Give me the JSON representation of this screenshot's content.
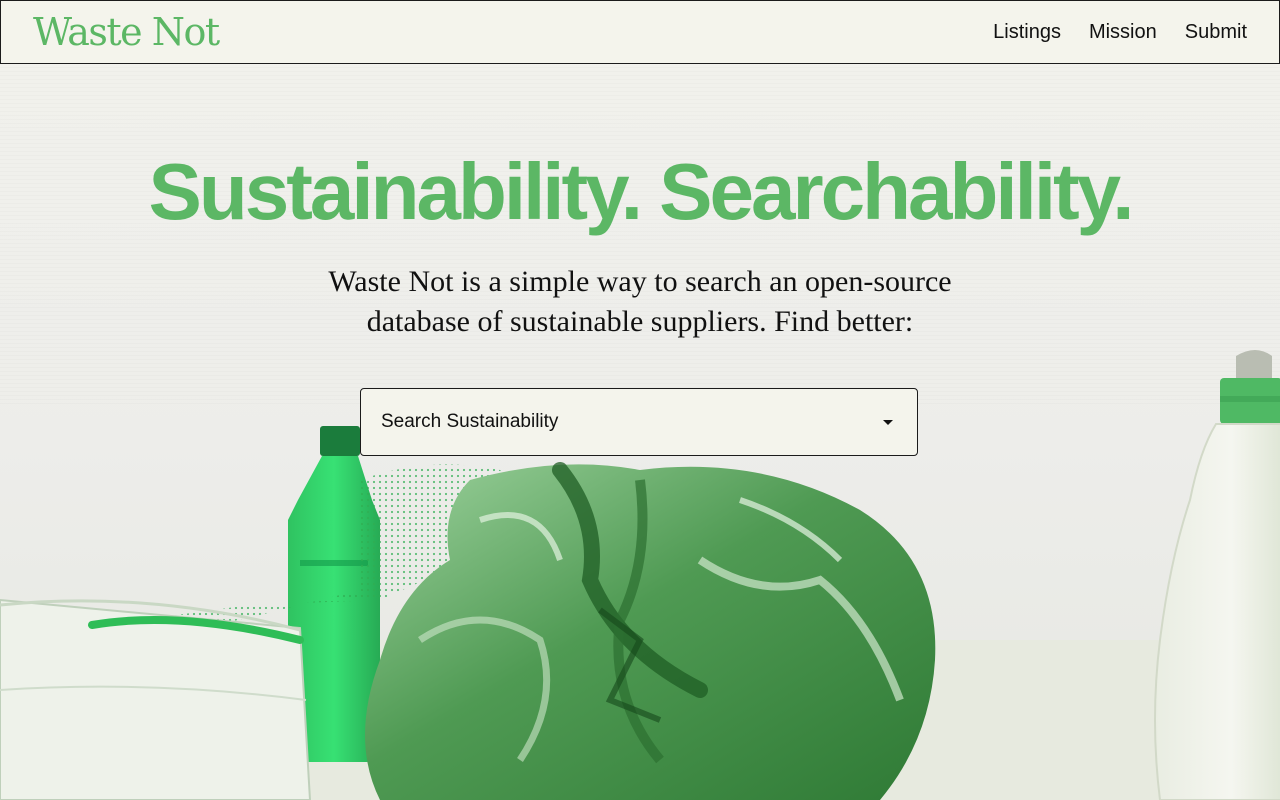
{
  "brand": {
    "logo_text": "Waste Not",
    "accent_color": "#5cb765"
  },
  "nav": {
    "items": [
      {
        "label": "Listings"
      },
      {
        "label": "Mission"
      },
      {
        "label": "Submit"
      }
    ]
  },
  "hero": {
    "title": "Sustainability. Searchability.",
    "description": "Waste Not is a simple way to search an open-source database of sustainable suppliers. Find better:"
  },
  "search": {
    "selected_value": "Search Sustainability",
    "caret_icon": "caret-down-icon"
  },
  "background": {
    "image_subject": "hero-photo-plastic-waste"
  }
}
